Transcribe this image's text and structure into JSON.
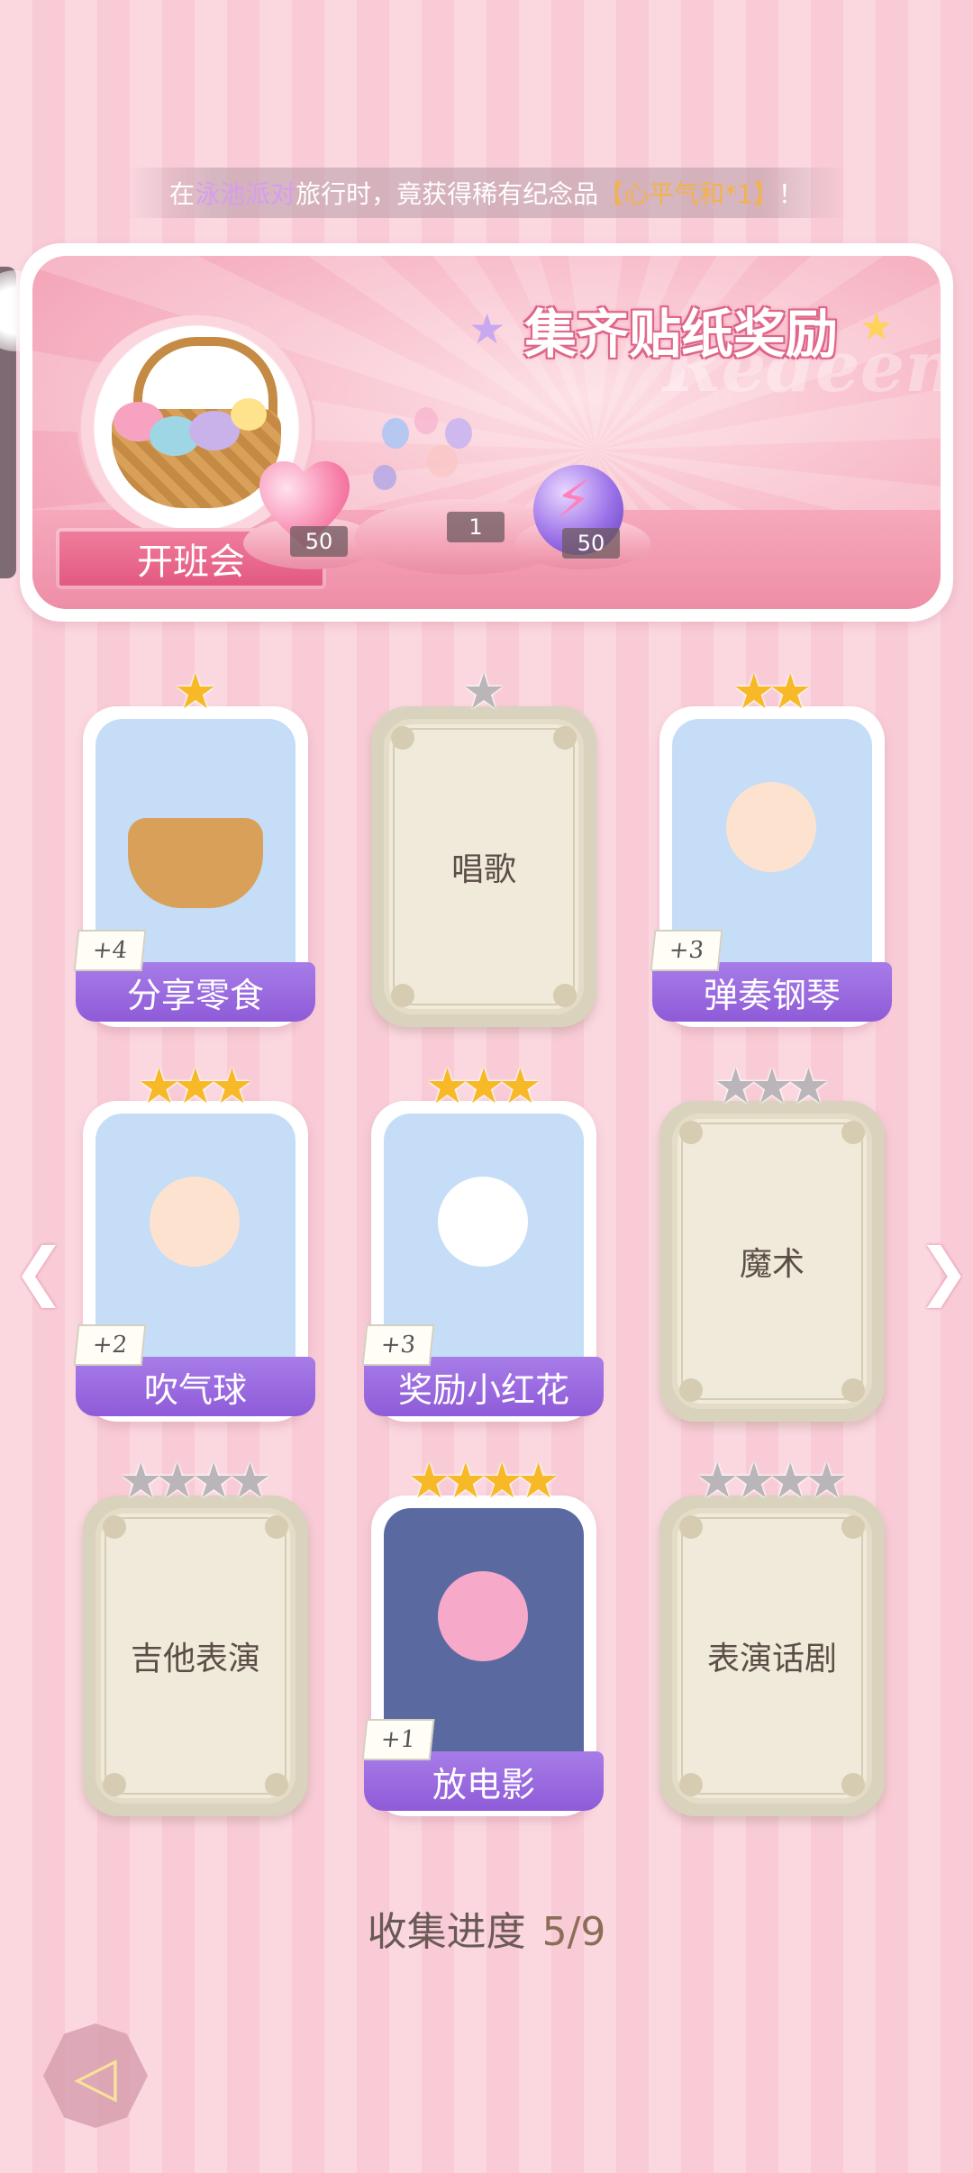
{
  "notice": {
    "prefix": "在",
    "place": "泳池派对",
    "middle": "旅行时，竟获得稀有纪念品",
    "item": "【心平气和*1】",
    "suffix": "！"
  },
  "banner": {
    "title": "集齐贴纸奖励",
    "watermark": "Redeem",
    "event_label": "开班会",
    "rewards": [
      {
        "icon": "heart-gem-icon",
        "count": "50"
      },
      {
        "icon": "balloon-bunch-icon",
        "count": "1"
      },
      {
        "icon": "energy-orb-icon",
        "count": "50"
      }
    ]
  },
  "cards": [
    {
      "label": "分享零食",
      "bonus": "+4",
      "stars": 1,
      "max_stars": 1,
      "unlocked": true,
      "art": "snack-basket"
    },
    {
      "label": "唱歌",
      "bonus": "",
      "stars": 0,
      "max_stars": 1,
      "unlocked": false
    },
    {
      "label": "弹奏钢琴",
      "bonus": "+3",
      "stars": 2,
      "max_stars": 2,
      "unlocked": true,
      "art": "piano-boy"
    },
    {
      "label": "吹气球",
      "bonus": "+2",
      "stars": 3,
      "max_stars": 3,
      "unlocked": true,
      "art": "bubble-boy"
    },
    {
      "label": "奖励小红花",
      "bonus": "+3",
      "stars": 3,
      "max_stars": 3,
      "unlocked": true,
      "art": "rabbit-flower"
    },
    {
      "label": "魔术",
      "bonus": "",
      "stars": 0,
      "max_stars": 3,
      "unlocked": false
    },
    {
      "label": "吉他表演",
      "bonus": "",
      "stars": 0,
      "max_stars": 4,
      "unlocked": false
    },
    {
      "label": "放电影",
      "bonus": "+1",
      "stars": 4,
      "max_stars": 4,
      "unlocked": true,
      "art": "movie-girl"
    },
    {
      "label": "表演话剧",
      "bonus": "",
      "stars": 0,
      "max_stars": 4,
      "unlocked": false
    }
  ],
  "progress": {
    "label": "收集进度",
    "value": "5/9"
  },
  "colors": {
    "accent_purple": "#9a66de",
    "star_gold": "#f7b928",
    "star_grey": "#b9b5b8",
    "banner_pink": "#f29ab0"
  }
}
